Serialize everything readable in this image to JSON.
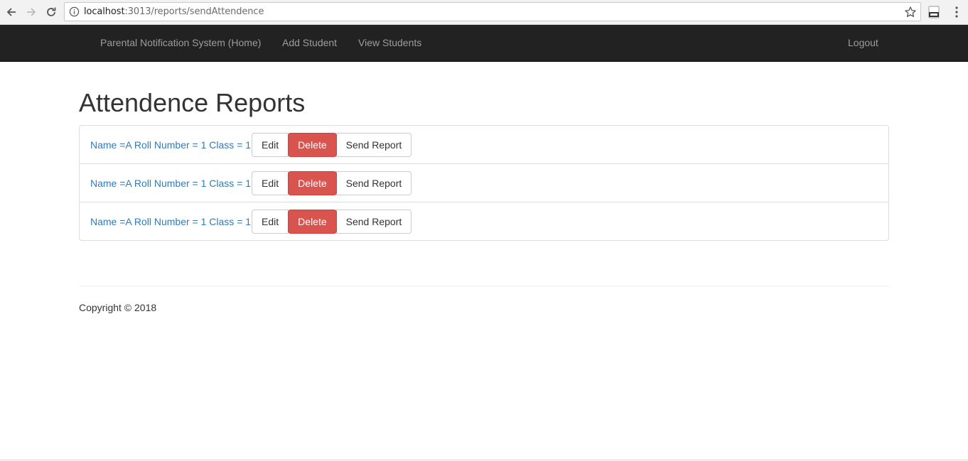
{
  "browser": {
    "url_host": "localhost",
    "url_path": ":3013/reports/sendAttendence"
  },
  "navbar": {
    "brand": "Parental Notification System (Home)",
    "links": [
      "Add Student",
      "View Students"
    ],
    "logout": "Logout"
  },
  "page": {
    "title": "Attendence Reports"
  },
  "reports": [
    {
      "label": "Name =A Roll Number = 1 Class = 1",
      "edit": "Edit",
      "delete": "Delete",
      "send": "Send Report"
    },
    {
      "label": "Name =A Roll Number = 1 Class = 1",
      "edit": "Edit",
      "delete": "Delete",
      "send": "Send Report"
    },
    {
      "label": "Name =A Roll Number = 1 Class = 1",
      "edit": "Edit",
      "delete": "Delete",
      "send": "Send Report"
    }
  ],
  "footer": {
    "copyright": "Copyright © 2018"
  },
  "colors": {
    "navbar_bg": "#222222",
    "link": "#337ab7",
    "danger": "#d9534f"
  }
}
